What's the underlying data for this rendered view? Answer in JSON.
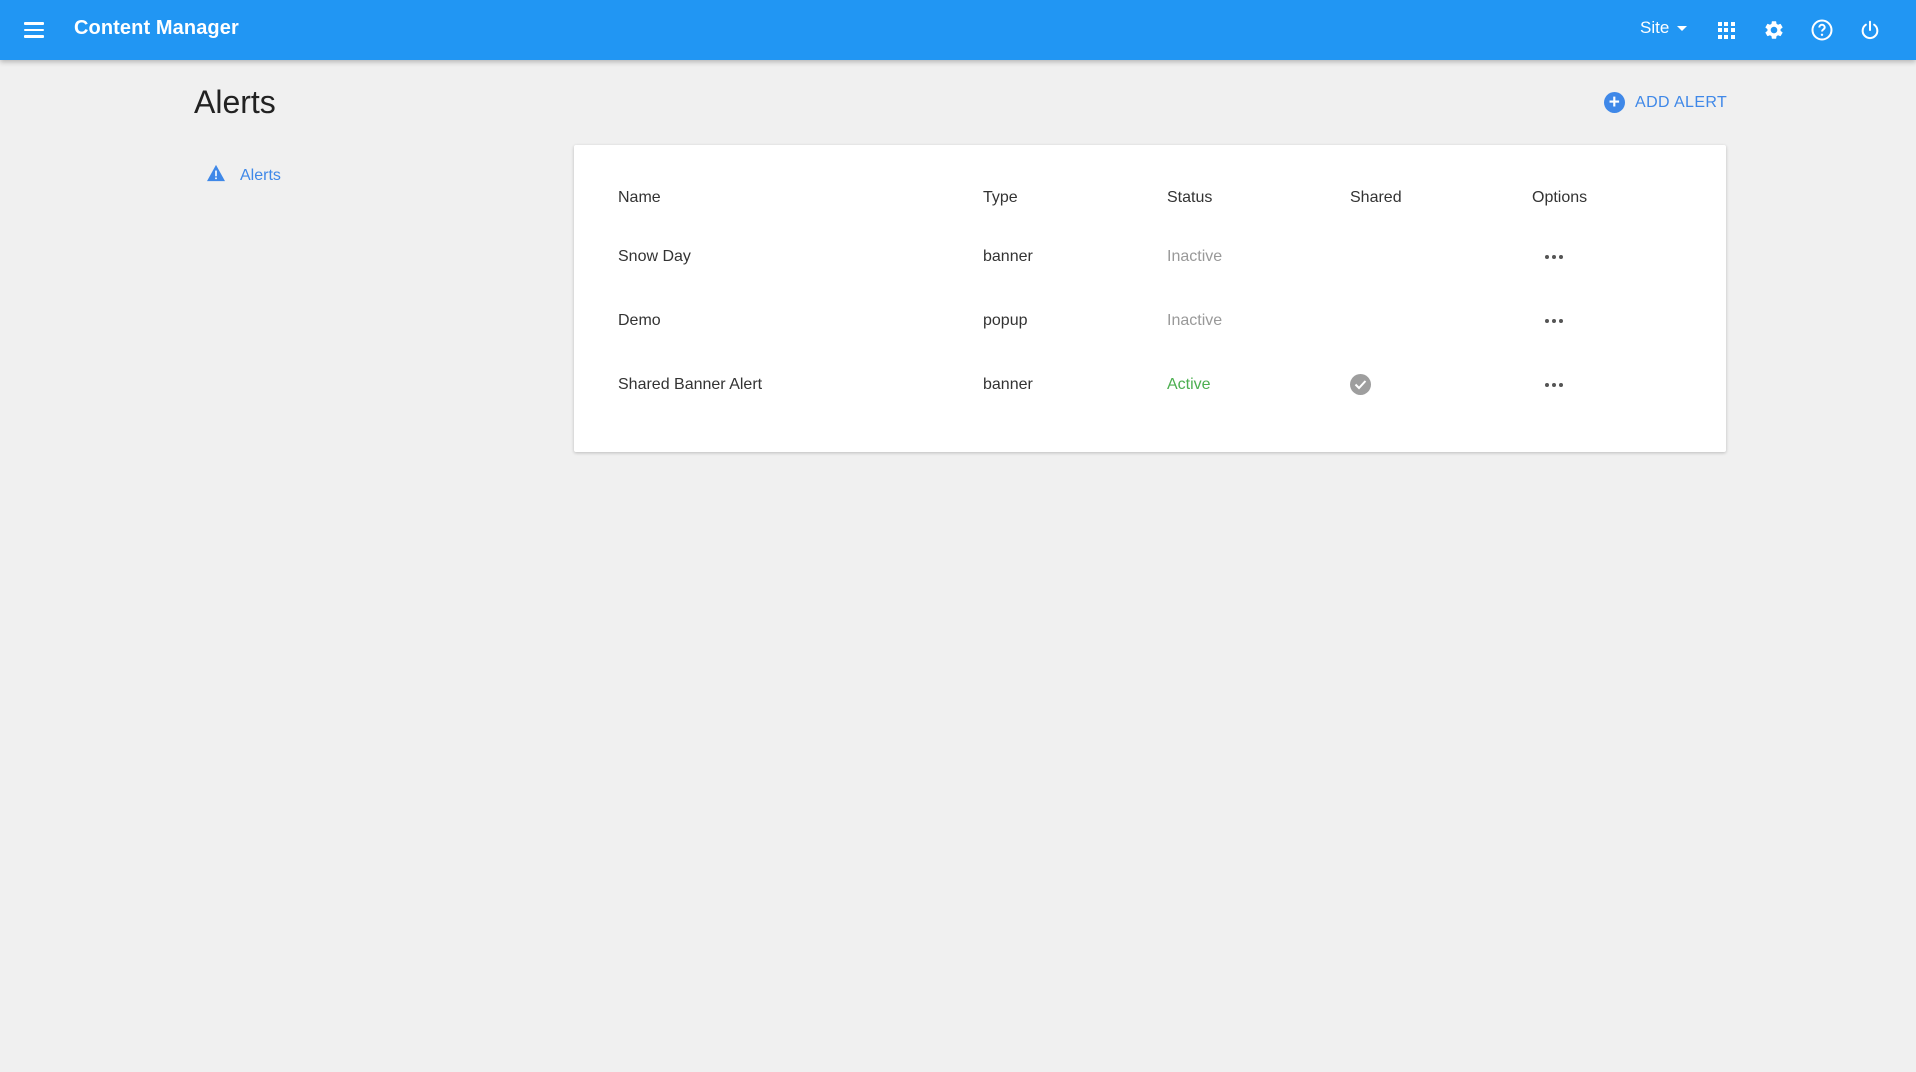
{
  "appbar": {
    "title": "Content Manager",
    "site_label": "Site",
    "color": "#2196f3",
    "icons": [
      "menu-icon",
      "apps-icon",
      "gear-icon",
      "help-icon",
      "power-icon"
    ]
  },
  "page": {
    "title": "Alerts",
    "add_button_label": "ADD ALERT"
  },
  "sidebar": {
    "items": [
      {
        "label": "Alerts",
        "icon": "warning-icon"
      }
    ]
  },
  "table": {
    "headers": [
      "Name",
      "Type",
      "Status",
      "Shared",
      "Options"
    ],
    "rows": [
      {
        "name": "Snow Day",
        "type": "banner",
        "status": "Inactive",
        "shared": false
      },
      {
        "name": "Demo",
        "type": "popup",
        "status": "Inactive",
        "shared": false
      },
      {
        "name": "Shared Banner Alert",
        "type": "banner",
        "status": "Active",
        "shared": true
      }
    ]
  },
  "colors": {
    "accent": "#3f88e8",
    "active": "#4caf50",
    "inactive": "#999999",
    "background": "#f0f0f0"
  }
}
